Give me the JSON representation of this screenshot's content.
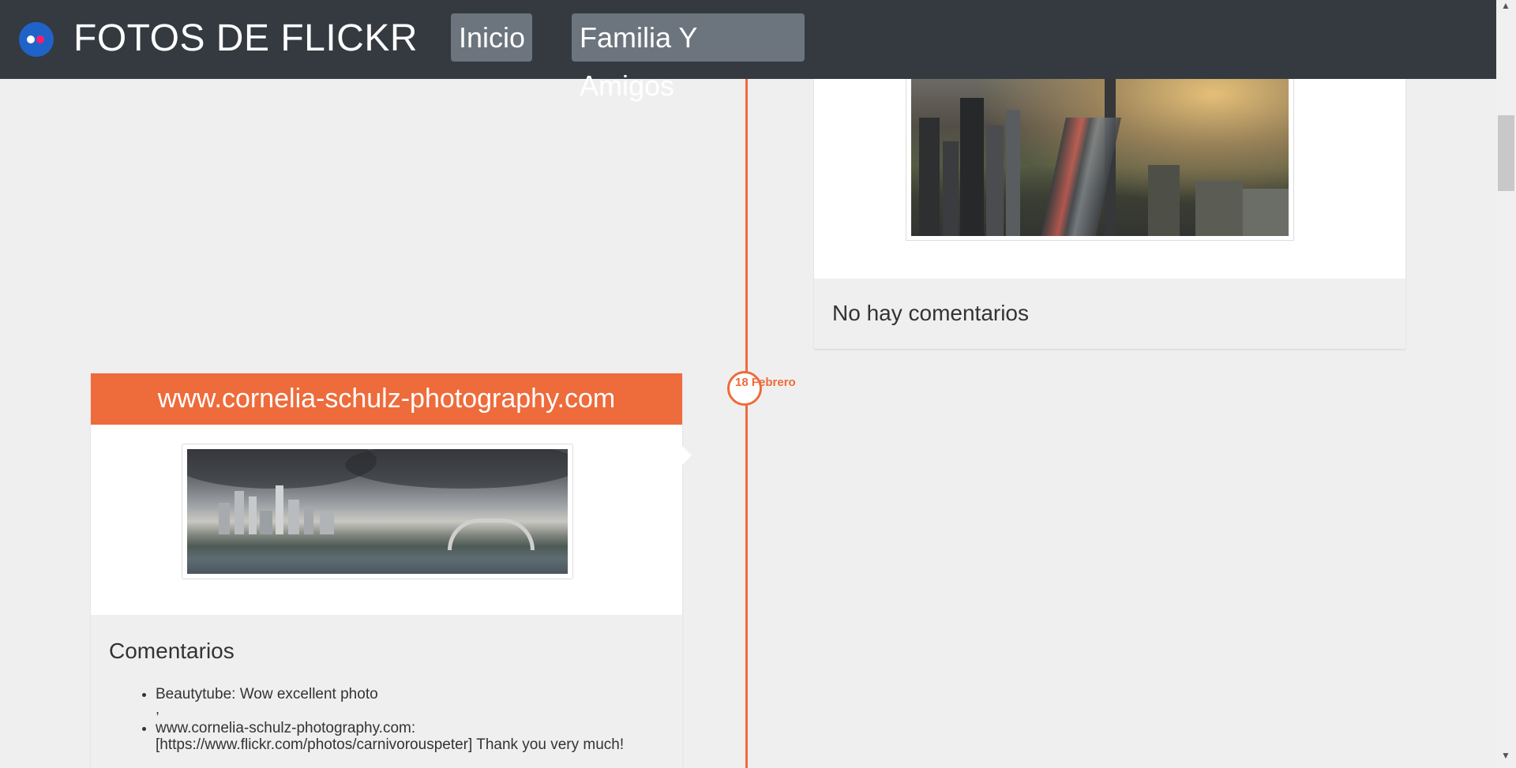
{
  "navbar": {
    "brand": "FOTOS DE FLICKR",
    "links": [
      {
        "label": "Inicio"
      },
      {
        "label": "Familia Y Amigos"
      }
    ]
  },
  "timeline": {
    "date_label": "18 Febrero"
  },
  "card_top_right": {
    "no_comments": "No hay comentarios"
  },
  "card_left": {
    "title": "www.cornelia-schulz-photography.com",
    "comments_title": "Comentarios",
    "comments": [
      {
        "text": "Beautytube: Wow excellent photo",
        "separator": ","
      },
      {
        "text": "www.cornelia-schulz-photography.com: [https://www.flickr.com/photos/carnivorouspeter] Thank you very much!",
        "separator": ""
      }
    ]
  },
  "colors": {
    "accent": "#ee6b3b",
    "navbar": "#343a40",
    "nav_button": "#6c757d",
    "background": "#efefef"
  },
  "icons": {
    "logo": "flickr-logo-icon",
    "scroll_up": "chevron-up-icon",
    "scroll_down": "chevron-down-icon"
  }
}
